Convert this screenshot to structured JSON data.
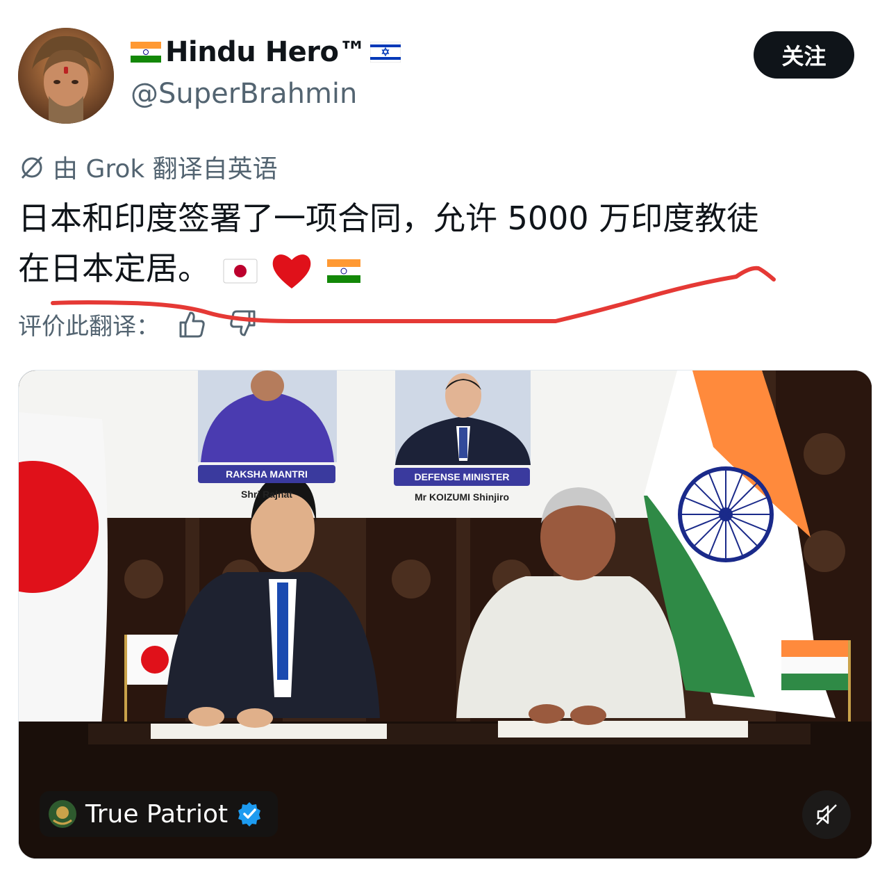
{
  "header": {
    "display_name": "Hindu Hero™",
    "handle": "@SuperBrahmin",
    "follow_label": "关注",
    "name_prefix_flag": "india-flag-icon",
    "name_suffix_flag": "israel-flag-icon"
  },
  "translation": {
    "label": "由 Grok 翻译自英语",
    "text_line1": "日本和印度签署了一项合同，允许 5000 万印度教徒",
    "text_line2": "在日本定居。",
    "emojis": [
      "japan-flag-icon",
      "red-heart-icon",
      "india-flag-icon"
    ],
    "rate_label": "评价此翻译："
  },
  "media": {
    "placard_left_title": "RAKSHA MANTRI",
    "placard_left_name": "Shri Rajnat",
    "placard_right_title": "DEFENSE MINISTER",
    "placard_right_name": "Mr KOIZUMI Shinjiro",
    "source_name": "True Patriot"
  },
  "colors": {
    "text_primary": "#0f1419",
    "text_secondary": "#536471",
    "follow_bg": "#0f1419",
    "annotation_red": "#e53935",
    "verified_blue": "#1d9bf0"
  }
}
